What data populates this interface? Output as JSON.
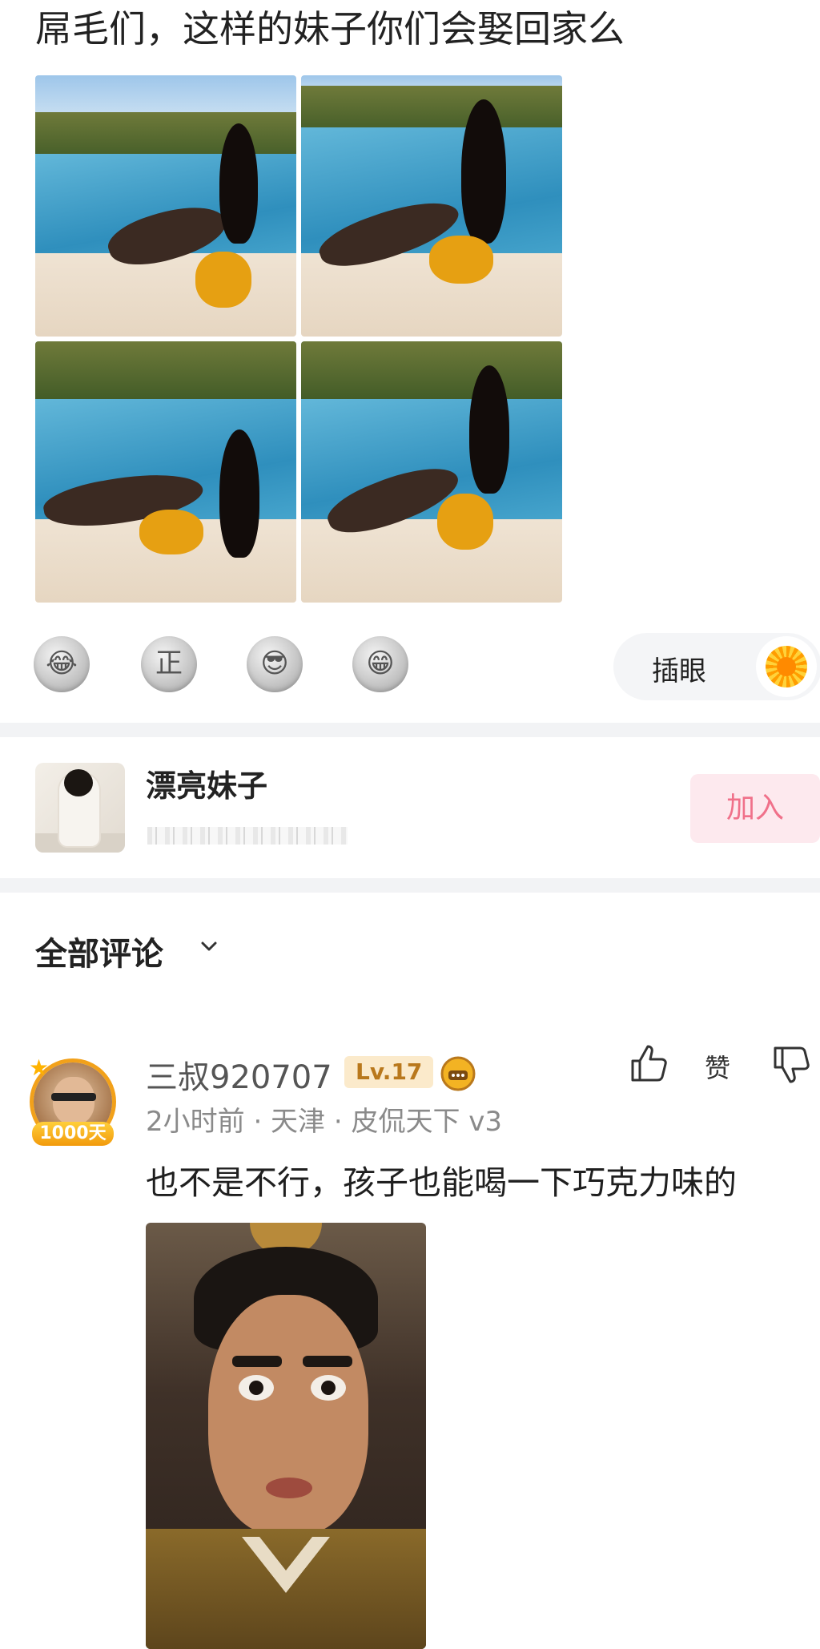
{
  "post": {
    "title": "屌毛们，这样的妹子你们会娶回家么"
  },
  "reactions": {
    "emojis": [
      "laughing-cry-emoji",
      "zheng-emoji",
      "sunglasses-emoji",
      "grin-emoji"
    ],
    "zheng_glyph": "正",
    "poke_label": "插眼",
    "poke_icon": "sunflower-icon"
  },
  "group": {
    "name": "漂亮妹子",
    "join_label": "加入"
  },
  "comments_header": {
    "title": "全部评论"
  },
  "comment": {
    "username": "三叔920707",
    "level": "Lv.17",
    "badge": "1000天",
    "meta": "2小时前 · 天津 · 皮侃天下 v3",
    "text": "也不是不行，孩子也能喝一下巧克力味的",
    "like_label": "赞"
  },
  "colors": {
    "join_bg": "#fde9ee",
    "join_text": "#f0718a",
    "level_bg": "#fbeacb",
    "level_text": "#b9781c",
    "divider": "#f2f3f5"
  }
}
